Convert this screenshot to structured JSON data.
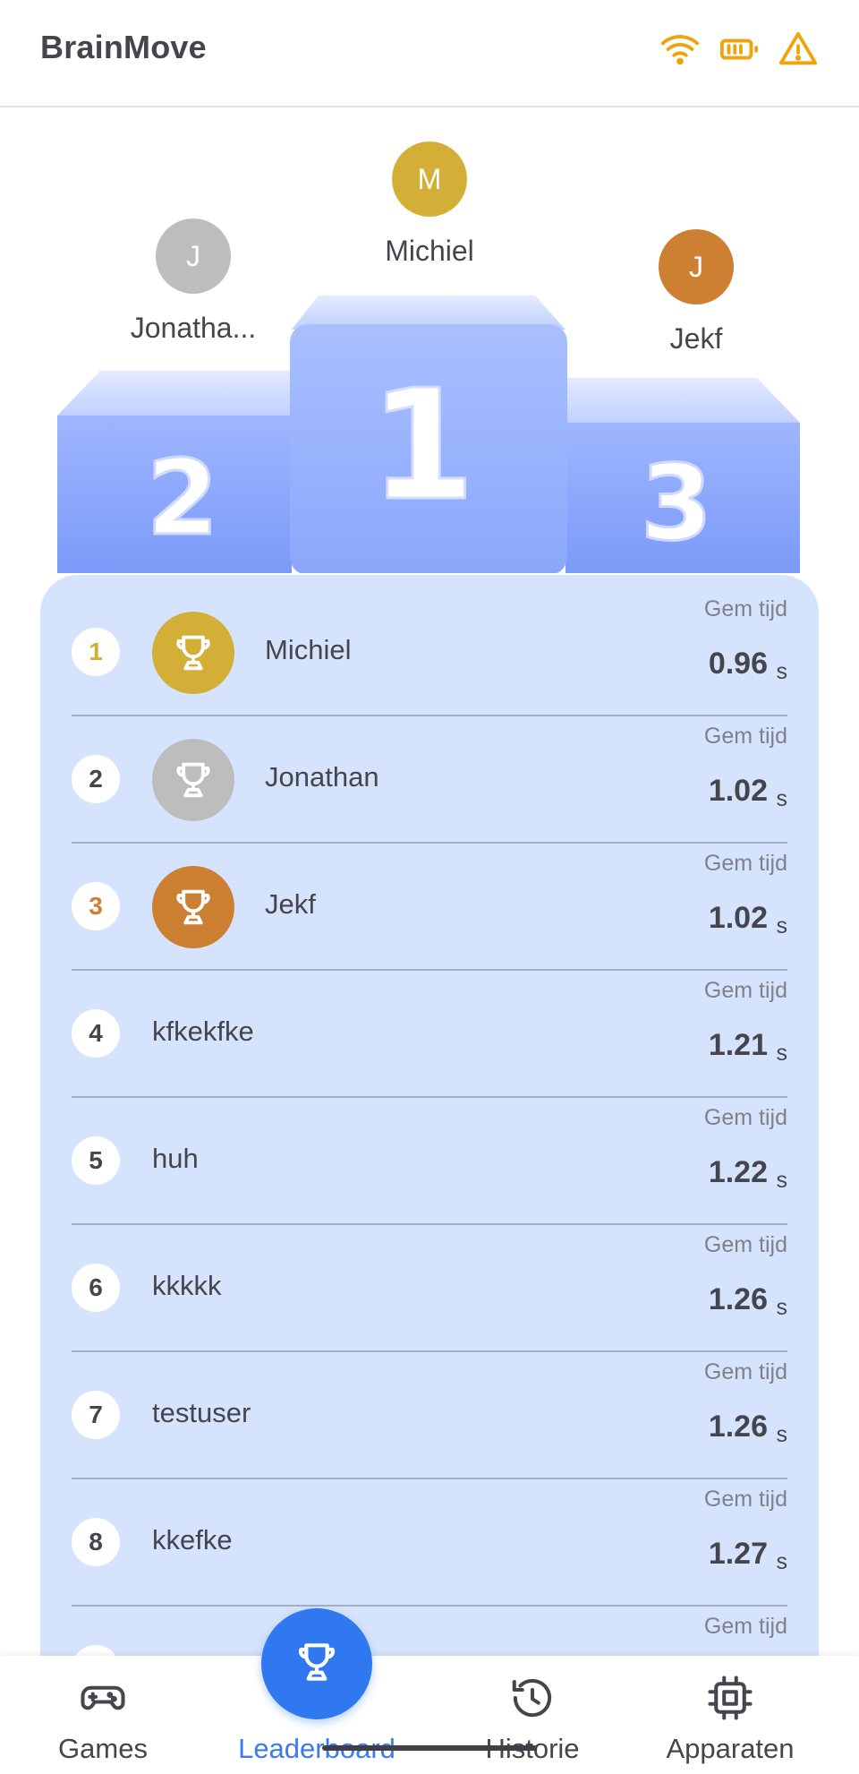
{
  "app": {
    "title": "BrainMove"
  },
  "status_icons": [
    {
      "name": "wifi-icon",
      "color": "#f0a30a"
    },
    {
      "name": "battery-icon",
      "color": "#f0a30a"
    },
    {
      "name": "warning-icon",
      "color": "#f0a30a"
    }
  ],
  "podium": {
    "first": {
      "initial": "M",
      "name": "Michiel",
      "color": "#d4af37",
      "place": "1"
    },
    "second": {
      "initial": "J",
      "name": "Jonatha...",
      "color": "#bdbdbd",
      "place": "2"
    },
    "third": {
      "initial": "J",
      "name": "Jekf",
      "color": "#cd7f32",
      "place": "3"
    }
  },
  "leaderboard": {
    "gem_label": "Gem tijd",
    "unit": "s",
    "rows": [
      {
        "rank": "1",
        "name": "Michiel",
        "time": "0.96",
        "trophy": "#d4af37",
        "rank_color": "#d4af37"
      },
      {
        "rank": "2",
        "name": "Jonathan",
        "time": "1.02",
        "trophy": "#bdbdbd",
        "rank_color": "#45464d"
      },
      {
        "rank": "3",
        "name": "Jekf",
        "time": "1.02",
        "trophy": "#cd7f32",
        "rank_color": "#cd7f32"
      },
      {
        "rank": "4",
        "name": "kfkekfke",
        "time": "1.21"
      },
      {
        "rank": "5",
        "name": "huh",
        "time": "1.22"
      },
      {
        "rank": "6",
        "name": "kkkkk",
        "time": "1.26"
      },
      {
        "rank": "7",
        "name": "testuser",
        "time": "1.26"
      },
      {
        "rank": "8",
        "name": "kkefke",
        "time": "1.27"
      },
      {
        "rank": "",
        "name": "",
        "time": ""
      }
    ]
  },
  "nav": {
    "items": [
      {
        "label": "Games",
        "icon": "gamepad-icon"
      },
      {
        "label": "Leaderboard",
        "icon": "trophy-icon",
        "active": true
      },
      {
        "label": "Historie",
        "icon": "history-icon"
      },
      {
        "label": "Apparaten",
        "icon": "chip-icon"
      }
    ],
    "accent": "#2f78f0"
  }
}
